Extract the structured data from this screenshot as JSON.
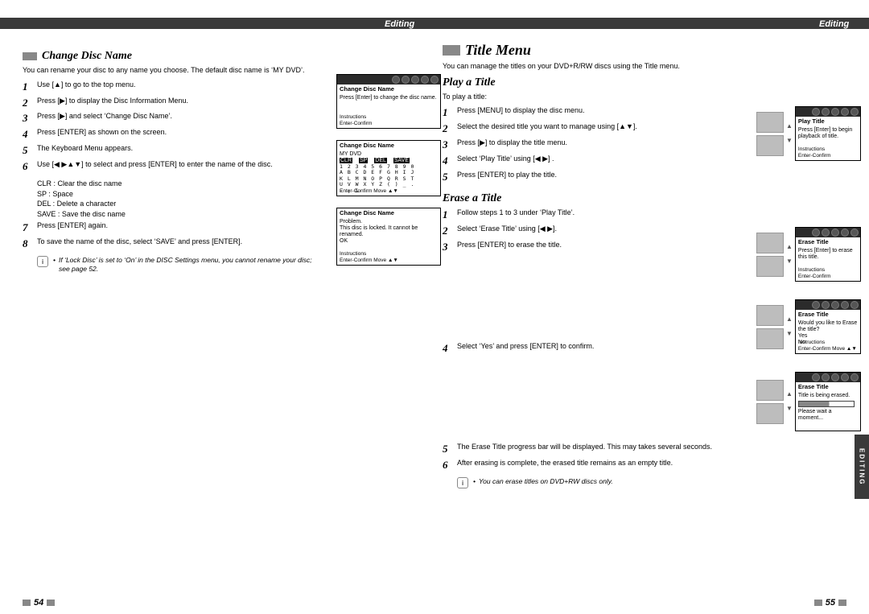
{
  "header": {
    "section": "Editing"
  },
  "side_tab": "EDITING",
  "left_page": {
    "title": "Change Disc Name",
    "intro": "You can rename your disc to any name you choose. The default disc name is ‘MY DVD’.",
    "steps": [
      "Use [▲] to go to the top menu.",
      "Press [▶] to display the Disc Information Menu.",
      "Press [▶] and select ‘Change Disc Name’.",
      "Press [ENTER] as shown on the screen.",
      "The Keyboard Menu appears.",
      "Use [◀ ▶▲▼] to select and press [ENTER] to enter the name of the disc.",
      "Press [ENTER] again.",
      "To save the name of the disc, select ‘SAVE’ and press [ENTER]."
    ],
    "substeps": [
      "CLR : Clear the disc name",
      "SP : Space",
      "DEL : Delete a character",
      "SAVE : Save the disc name"
    ],
    "note": "If ‘Lock Disc’ is set to ‘On’ in the DISC Settings menu, you cannot rename your disc; see page 52.",
    "osd1": {
      "title": "Change Disc Name",
      "msg": "Press [Enter] to change the disc name.",
      "instr1": "Instructions",
      "instr2": "Enter-Confirm"
    },
    "osd2": {
      "title": "Change Disc Name",
      "line1": "MY DVD",
      "row1a": "CLR",
      "row1b": "SP",
      "row1c": "DEL",
      "row1d": "SAVE",
      "grid": "1 2 3 4 5 6 7 8 9 0\nA B C D E F G H I J\nK L M N O P Q R S T\nU V W X Y Z ( ) _ .\n- ; &",
      "instr1": "Enter-Confirm   Move ▲▼"
    },
    "osd3": {
      "title": "Change Disc Name",
      "msg": "Problem.\nThis disc is locked. It cannot be renamed.\nOK",
      "instr1": "Instructions",
      "instr2": "Enter-Confirm   Move ▲▼"
    },
    "page_num": "54"
  },
  "right_page": {
    "chapter": "Title Menu",
    "chapter_intro": "You can manage the titles on your DVD+R/RW discs using the Title menu.",
    "play": {
      "title": "Play a Title",
      "intro": "To play a title:",
      "steps": [
        "Press [MENU] to display the disc menu.",
        "Select the desired title you want to manage using [▲▼].",
        "Press [▶] to display the title menu.",
        "Select ‘Play Title’ using [◀ ▶] .",
        "Press [ENTER] to play the title."
      ],
      "osd": {
        "title": "Play Title",
        "msg": "Press [Enter] to begin playback of title.",
        "instr1": "Instructions",
        "instr2": "Enter-Confirm"
      }
    },
    "erase": {
      "title": "Erase a Title",
      "steps_a": [
        "Follow steps 1 to 3 under ‘Play Title’.",
        "Select ‘Erase Title’ using [◀ ▶].",
        "Press [ENTER] to erase the title."
      ],
      "osd_a": {
        "title": "Erase Title",
        "msg": "Press [Enter] to erase this title.",
        "instr1": "Instructions",
        "instr2": "Enter-Confirm"
      },
      "step_b_num": "4",
      "step_b": "Select ‘Yes’  and press [ENTER] to confirm.",
      "osd_b": {
        "title": "Erase Title",
        "msg": "Would you like to Erase the title?\nYes\nNo",
        "instr1": "Instructions",
        "instr2": "Enter-Confirm   Move ▲▼"
      },
      "step_c_num": "5",
      "step_c": "The Erase Title progress bar will be displayed. This may takes several seconds.",
      "step_d_num": "6",
      "step_d": "After erasing is complete, the erased title remains as an empty title.",
      "note": "You can erase titles on DVD+RW discs only.",
      "osd_c": {
        "title": "Erase Title",
        "msg": "Title is being erased.",
        "wait": "Please wait a moment..."
      }
    },
    "page_num": "55"
  }
}
